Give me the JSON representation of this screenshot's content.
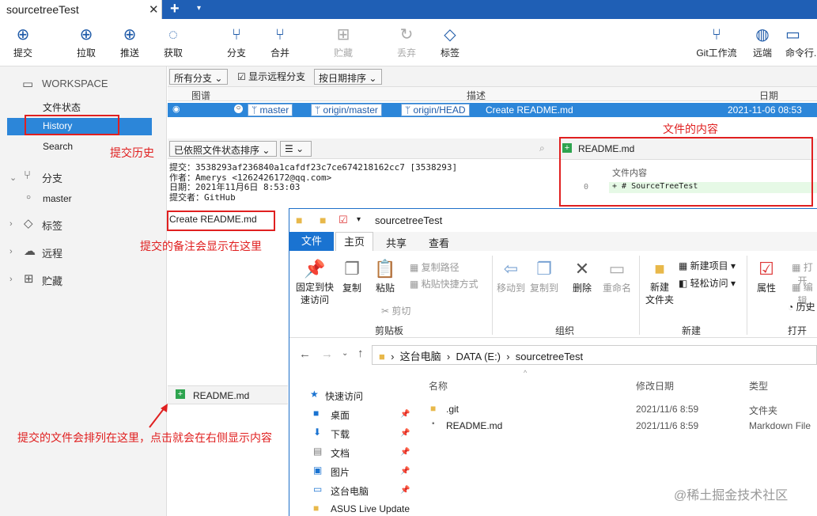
{
  "tab": {
    "title": "sourcetreeTest",
    "close": "✕",
    "add": "+",
    "more": "▾"
  },
  "toolbar": {
    "commit": "提交",
    "pull": "拉取",
    "push": "推送",
    "fetch": "获取",
    "branch": "分支",
    "merge": "合并",
    "stash": "贮藏",
    "discard": "丢弃",
    "tag": "标签",
    "gitflow": "Git工作流",
    "remote": "远端",
    "terminal": "命令行..."
  },
  "sidebar": {
    "workspace": "WORKSPACE",
    "file_status": "文件状态",
    "history": "History",
    "search": "Search",
    "branches": "分支",
    "master": "master",
    "tags": "标签",
    "remotes": "远程",
    "stashes": "贮藏"
  },
  "filters": {
    "all_branches": "所有分支",
    "show_remote": "显示远程分支",
    "sort_date": "按日期排序"
  },
  "columns": {
    "graph": "图谱",
    "desc": "描述",
    "date": "日期"
  },
  "commit_row": {
    "branch1": "master",
    "branch2": "origin/master",
    "branch3": "origin/HEAD",
    "message": "Create README.md",
    "date": "2021-11-06 08:53"
  },
  "details": {
    "sort": "已依照文件状态排序",
    "commit_line": "提交：3538293af236840a1cafdf23c7ce674218162cc7 [3538293]",
    "author_line": "作者：Amerys <1262426172@qq.com>",
    "date_line": "日期：2021年11月6日 8:53:03",
    "committer_line": "提交者：GitHub",
    "message": "Create README.md",
    "file": "README.md"
  },
  "content_pane": {
    "file": "README.md",
    "header": "文件内容",
    "line_no": "0",
    "line": "+ # SourceTreeTest"
  },
  "annotations": {
    "history": "提交历史",
    "content": "文件的内容",
    "message": "提交的备注会显示在这里",
    "files": "提交的文件会排列在这里，点击就会在右侧显示内容"
  },
  "explorer": {
    "title": "sourcetreeTest",
    "tabs": {
      "file": "文件",
      "home": "主页",
      "share": "共享",
      "view": "查看"
    },
    "ribbon": {
      "pin": "固定到快\n速访问",
      "copy": "复制",
      "paste": "粘贴",
      "copy_path": "复制路径",
      "paste_shortcut": "粘贴快捷方式",
      "cut": "剪切",
      "move_to": "移动到",
      "copy_to": "复制到",
      "delete": "删除",
      "rename": "重命名",
      "new_folder": "新建\n文件夹",
      "new_item": "新建项目",
      "easy_access": "轻松访问",
      "properties": "属性",
      "open": "打开",
      "edit": "编辑",
      "history": "历史",
      "g_clipboard": "剪贴板",
      "g_organize": "组织",
      "g_new": "新建",
      "g_open": "打开"
    },
    "address": {
      "pc": "这台电脑",
      "drive": "DATA (E:)",
      "folder": "sourcetreeTest"
    },
    "nav": {
      "quick_access": "快速访问",
      "desktop": "桌面",
      "downloads": "下载",
      "documents": "文档",
      "pictures": "图片",
      "this_pc": "这台电脑",
      "asus": "ASUS Live Update"
    },
    "columns": {
      "name": "名称",
      "modified": "修改日期",
      "type": "类型"
    },
    "files": [
      {
        "name": ".git",
        "modified": "2021/11/6 8:59",
        "type": "文件夹"
      },
      {
        "name": "README.md",
        "modified": "2021/11/6 8:59",
        "type": "Markdown File"
      }
    ]
  },
  "watermark": "@稀土掘金技术社区"
}
